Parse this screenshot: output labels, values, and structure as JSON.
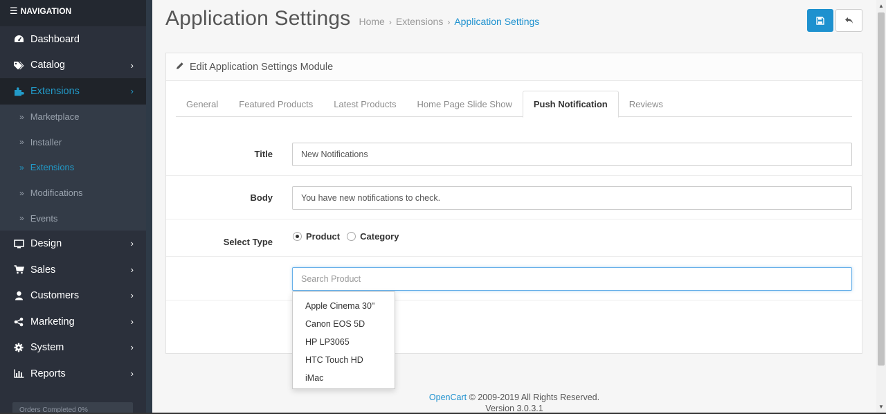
{
  "nav": {
    "header": "NAVIGATION",
    "items": [
      {
        "label": "Dashboard",
        "icon": "dashboard-icon",
        "chev": ""
      },
      {
        "label": "Catalog",
        "icon": "tags-icon",
        "chev": "›"
      },
      {
        "label": "Extensions",
        "icon": "puzzle-icon",
        "chev": "›"
      },
      {
        "label": "Design",
        "icon": "monitor-icon",
        "chev": "›"
      },
      {
        "label": "Sales",
        "icon": "cart-icon",
        "chev": "›"
      },
      {
        "label": "Customers",
        "icon": "user-icon",
        "chev": "›"
      },
      {
        "label": "Marketing",
        "icon": "share-icon",
        "chev": "›"
      },
      {
        "label": "System",
        "icon": "cog-icon",
        "chev": "›"
      },
      {
        "label": "Reports",
        "icon": "bar-chart-icon",
        "chev": "›"
      }
    ],
    "sub": [
      {
        "label": "Marketplace"
      },
      {
        "label": "Installer"
      },
      {
        "label": "Extensions"
      },
      {
        "label": "Modifications"
      },
      {
        "label": "Events"
      }
    ],
    "raquo": "»",
    "progress_stub": "Orders Completed   0%"
  },
  "header": {
    "title": "Application Settings",
    "breadcrumb": [
      "Home",
      "Extensions",
      "Application Settings"
    ],
    "sep": "›"
  },
  "panel": {
    "heading": "Edit Application Settings Module"
  },
  "tabs": [
    "General",
    "Featured Products",
    "Latest Products",
    "Home Page Slide Show",
    "Push Notification",
    "Reviews"
  ],
  "form": {
    "title_label": "Title",
    "title_value": "New Notifications",
    "body_label": "Body",
    "body_value": "You have new notifications to check.",
    "type_label": "Select Type",
    "type_options": [
      "Product",
      "Category"
    ],
    "search_placeholder": "Search Product"
  },
  "dropdown": [
    "Apple Cinema 30\"",
    "Canon EOS 5D",
    "HP LP3065",
    "HTC Touch HD",
    "iMac"
  ],
  "footer": {
    "brand": "OpenCart",
    "copyright": " © 2009-2019 All Rights Reserved.",
    "version": "Version 3.0.3.1"
  }
}
